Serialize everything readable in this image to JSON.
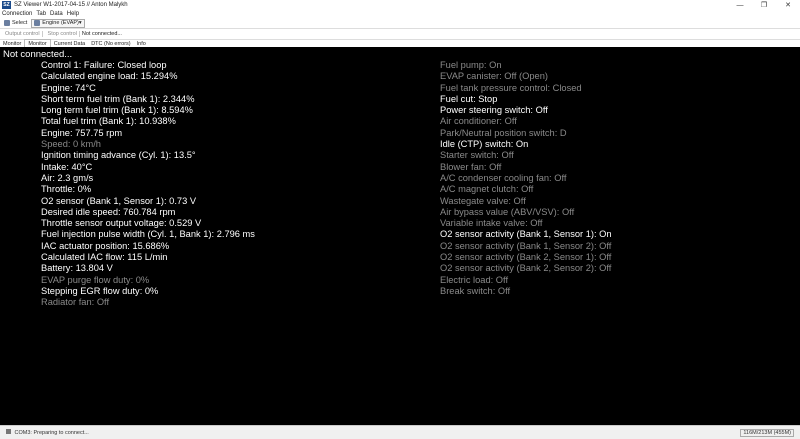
{
  "window": {
    "app_icon_text": "SZ",
    "title": "SZ Viewer W1-2017-04-15 // Anton Malykh",
    "controls": [
      "—",
      "❐",
      "✕"
    ]
  },
  "menu": [
    "Connection",
    "Tab",
    "Data",
    "Help"
  ],
  "toolbar": {
    "select_label": "Select",
    "engine_select": "Engine (EVAP)"
  },
  "toolbar2": {
    "output_control": "Output control",
    "stop_control": "Stop control",
    "status": "Not connected..."
  },
  "tabs": [
    "Monitor",
    "Monitor",
    "Current Data",
    "DTC (No errors)",
    "Info"
  ],
  "content": {
    "connection_message": "Not connected...",
    "left_params": [
      {
        "text": "Control 1: Failure: Closed loop",
        "active": true
      },
      {
        "text": "Calculated engine load: 15.294%",
        "active": true
      },
      {
        "text": "Engine: 74°C",
        "active": true
      },
      {
        "text": "Short term fuel trim (Bank 1): 2.344%",
        "active": true
      },
      {
        "text": "Long term fuel trim (Bank 1): 8.594%",
        "active": true
      },
      {
        "text": "Total fuel trim (Bank 1): 10.938%",
        "active": true
      },
      {
        "text": "Engine: 757.75 rpm",
        "active": true
      },
      {
        "text": "Speed: 0 km/h",
        "active": false
      },
      {
        "text": "Ignition timing advance (Cyl. 1): 13.5°",
        "active": true
      },
      {
        "text": "Intake: 40°C",
        "active": true
      },
      {
        "text": "Air: 2.3 gm/s",
        "active": true
      },
      {
        "text": "Throttle: 0%",
        "active": true
      },
      {
        "text": "O2 sensor (Bank 1, Sensor 1): 0.73 V",
        "active": true
      },
      {
        "text": "Desired idle speed: 760.784 rpm",
        "active": true
      },
      {
        "text": "Throttle sensor output voltage: 0.529 V",
        "active": true
      },
      {
        "text": "Fuel injection pulse width (Cyl. 1, Bank 1): 2.796 ms",
        "active": true
      },
      {
        "text": "IAC actuator position: 15.686%",
        "active": true
      },
      {
        "text": "Calculated IAC flow: 115 L/min",
        "active": true
      },
      {
        "text": "Battery: 13.804 V",
        "active": true
      },
      {
        "text": "EVAP purge flow duty: 0%",
        "active": false
      },
      {
        "text": "Stepping EGR flow duty: 0%",
        "active": true
      },
      {
        "text": "Radiator fan: Off",
        "active": false
      }
    ],
    "right_params": [
      {
        "text": "Fuel pump: On",
        "active": false
      },
      {
        "text": "EVAP canister: Off (Open)",
        "active": false
      },
      {
        "text": "Fuel tank pressure control: Closed",
        "active": false
      },
      {
        "text": "Fuel cut: Stop",
        "active": true
      },
      {
        "text": "Power steering switch: Off",
        "active": true
      },
      {
        "text": "Air conditioner: Off",
        "active": false
      },
      {
        "text": "Park/Neutral position switch: D",
        "active": false
      },
      {
        "text": "Idle (CTP) switch: On",
        "active": true
      },
      {
        "text": "Starter switch: Off",
        "active": false
      },
      {
        "text": "Blower fan: Off",
        "active": false
      },
      {
        "text": "A/C condenser cooling fan: Off",
        "active": false
      },
      {
        "text": "A/C magnet clutch: Off",
        "active": false
      },
      {
        "text": "Wastegate valve: Off",
        "active": false
      },
      {
        "text": "Air bypass value (ABV/VSV): Off",
        "active": false
      },
      {
        "text": "Variable intake valve: Off",
        "active": false
      },
      {
        "text": "O2 sensor activity (Bank 1, Sensor 1): On",
        "active": true
      },
      {
        "text": "O2 sensor activity (Bank 1, Sensor 2): Off",
        "active": false
      },
      {
        "text": "O2 sensor activity (Bank 2, Sensor 1): Off",
        "active": false
      },
      {
        "text": "O2 sensor activity (Bank 2, Sensor 2): Off",
        "active": false
      },
      {
        "text": "Electric load: Off",
        "active": false
      },
      {
        "text": "Break switch: Off",
        "active": false
      }
    ]
  },
  "statusbar": {
    "port_status": "COM3: Preparing to connect...",
    "memory": "116M/213M (455M)"
  }
}
